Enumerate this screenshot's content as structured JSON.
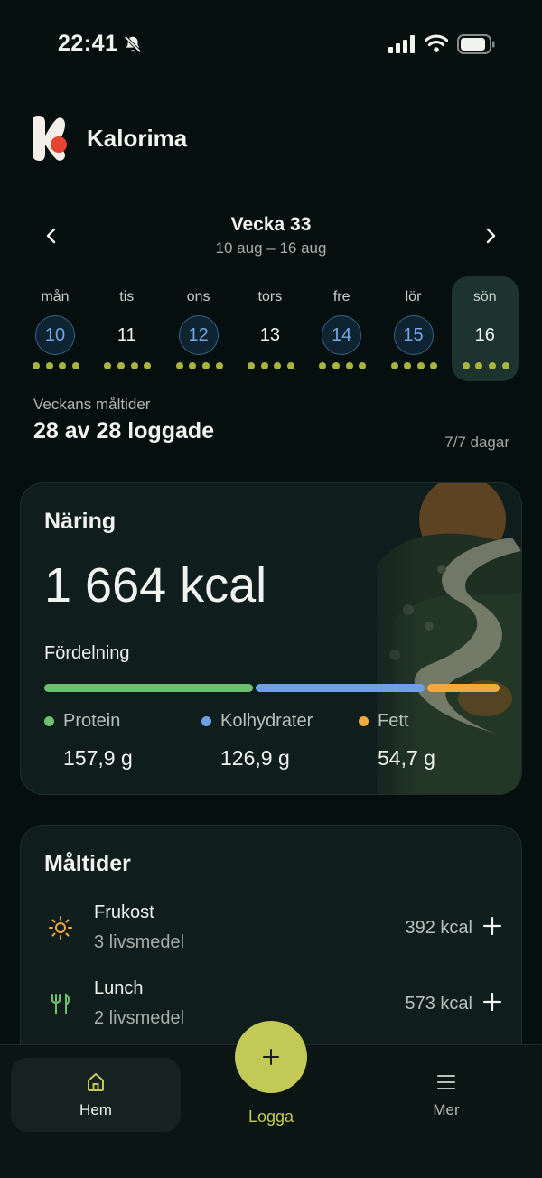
{
  "status_bar": {
    "time": "22:41"
  },
  "app": {
    "title": "Kalorima"
  },
  "week": {
    "title": "Vecka 33",
    "range": "10 aug – 16 aug"
  },
  "days": [
    {
      "name": "mån",
      "num": "10",
      "done": true
    },
    {
      "name": "tis",
      "num": "11",
      "done": false
    },
    {
      "name": "ons",
      "num": "12",
      "done": true
    },
    {
      "name": "tors",
      "num": "13",
      "done": false
    },
    {
      "name": "fre",
      "num": "14",
      "done": true
    },
    {
      "name": "lör",
      "num": "15",
      "done": true
    },
    {
      "name": "sön",
      "num": "16",
      "done": false,
      "active": true
    }
  ],
  "summary": {
    "label": "Veckans måltider",
    "value": "28 av 28 loggade",
    "days_count": "7/7 dagar"
  },
  "nutrition": {
    "title": "Näring",
    "total": "1 664 kcal",
    "distribution_label": "Fördelning",
    "macros": [
      {
        "name": "Protein",
        "value": "157,9 g",
        "color": "#6cc06f",
        "share": 0.46
      },
      {
        "name": "Kolhydrater",
        "value": "126,9 g",
        "color": "#6fa0e3",
        "share": 0.37
      },
      {
        "name": "Fett",
        "value": "54,7 g",
        "color": "#f0a93a",
        "share": 0.16
      }
    ]
  },
  "meals": {
    "title": "Måltider",
    "items": [
      {
        "name": "Frukost",
        "count": "3 livsmedel",
        "kcal": "392 kcal",
        "icon": "sun-icon"
      },
      {
        "name": "Lunch",
        "count": "2 livsmedel",
        "kcal": "573 kcal",
        "icon": "utensils-icon"
      }
    ]
  },
  "nav": {
    "home": "Hem",
    "log": "Logga",
    "more": "Mer"
  },
  "colors": {
    "accent": "#c3c957",
    "background": "#050f0e",
    "blue": "#72a6e6"
  }
}
